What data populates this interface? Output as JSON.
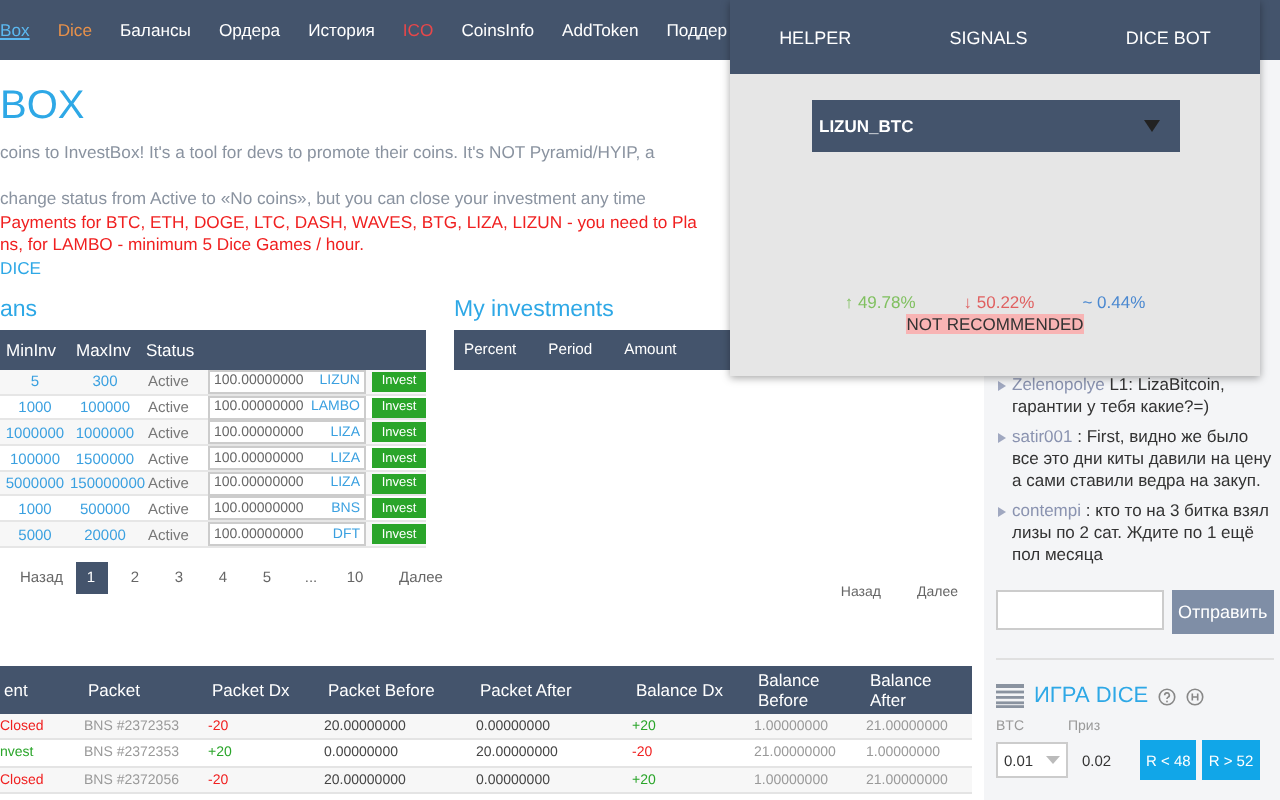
{
  "nav": {
    "items": [
      {
        "label": "Box",
        "selected": true
      },
      {
        "label": "Dice",
        "selected": false,
        "color": "#e8914a"
      },
      {
        "label": "Балансы",
        "selected": false
      },
      {
        "label": "Ордера",
        "selected": false
      },
      {
        "label": "История",
        "selected": false
      },
      {
        "label": "ICO",
        "selected": false,
        "color": "#e8474a"
      },
      {
        "label": "CoinsInfo",
        "selected": false
      },
      {
        "label": "AddToken",
        "selected": false
      },
      {
        "label": "Поддер",
        "selected": false
      }
    ]
  },
  "page_title": "BOX",
  "intro": [
    {
      "kind": "note",
      "text": "coins to InvestBox! It's a tool for devs to promote their coins. It's NOT Pyramid/HYIP, a"
    },
    {
      "kind": "note",
      "text": "change status from Active to «No coins», but you can close your investment any time"
    },
    {
      "kind": "warning",
      "text": "Payments for BTC, ETH, DOGE, LTC, DASH, WAVES, BTG, LIZA, LIZUN - you need to Pla"
    },
    {
      "kind": "warning",
      "text": "ns, for LAMBO - minimum 5 Dice Games / hour."
    },
    {
      "kind": "link",
      "text": "DICE"
    }
  ],
  "plans": {
    "title": "ans",
    "columns": [
      "MinInv",
      "MaxInv",
      "Status"
    ],
    "rows": [
      {
        "min": "5",
        "max": "300",
        "status": "Active",
        "amount": "100.00000000",
        "coin": "LIZUN",
        "button": "Invest"
      },
      {
        "min": "1000",
        "max": "100000",
        "status": "Active",
        "amount": "100.00000000",
        "coin": "LAMBO",
        "button": "Invest"
      },
      {
        "min": "1000000",
        "max": "1000000",
        "status": "Active",
        "amount": "100.00000000",
        "coin": "LIZA",
        "button": "Invest"
      },
      {
        "min": "100000",
        "max": "1500000",
        "status": "Active",
        "amount": "100.00000000",
        "coin": "LIZA",
        "button": "Invest"
      },
      {
        "min": "5000000",
        "max": "150000000",
        "status": "Active",
        "amount": "100.00000000",
        "coin": "LIZA",
        "button": "Invest"
      },
      {
        "min": "1000",
        "max": "500000",
        "status": "Active",
        "amount": "100.00000000",
        "coin": "BNS",
        "button": "Invest"
      },
      {
        "min": "5000",
        "max": "20000",
        "status": "Active",
        "amount": "100.00000000",
        "coin": "DFT",
        "button": "Invest"
      }
    ],
    "pagination": {
      "prev": "Назад",
      "pages": [
        {
          "label": "1",
          "selected": true
        },
        {
          "label": "2",
          "selected": false
        },
        {
          "label": "3",
          "selected": false
        },
        {
          "label": "4",
          "selected": false
        },
        {
          "label": "5",
          "selected": false
        },
        {
          "label": "...",
          "selected": false
        },
        {
          "label": "10",
          "selected": false
        }
      ],
      "next": "Далее"
    }
  },
  "investments": {
    "title": "My investments",
    "columns": [
      "Percent",
      "Period",
      "Amount"
    ],
    "pagination": {
      "prev": "Назад",
      "next": "Далее"
    }
  },
  "history": {
    "columns": [
      "ent",
      "Packet",
      "Packet Dx",
      "Packet Before",
      "Packet After",
      "Balance Dx",
      "Balance Before",
      "Balance After"
    ],
    "rows": [
      {
        "status": {
          "text": "Closed",
          "color": "#f02020"
        },
        "packet": "BNS #2372353",
        "packet_dx": {
          "value": "-20",
          "color": "#f02020"
        },
        "packet_before": "20.00000000",
        "packet_after": "0.00000000",
        "balance_dx": {
          "value": "+20",
          "color": "#2aa52a"
        },
        "balance_before": "1.00000000",
        "balance_after": "21.00000000"
      },
      {
        "status": {
          "text": "nvest",
          "color": "#2aa52a"
        },
        "packet": "BNS #2372353",
        "packet_dx": {
          "value": "+20",
          "color": "#2aa52a"
        },
        "packet_before": "0.00000000",
        "packet_after": "20.00000000",
        "balance_dx": {
          "value": "-20",
          "color": "#f02020"
        },
        "balance_before": "21.00000000",
        "balance_after": "1.00000000"
      },
      {
        "status": {
          "text": "Closed",
          "color": "#f02020"
        },
        "packet": "BNS #2372056",
        "packet_dx": {
          "value": "-20",
          "color": "#f02020"
        },
        "packet_before": "20.00000000",
        "packet_after": "0.00000000",
        "balance_dx": {
          "value": "+20",
          "color": "#2aa52a"
        },
        "balance_before": "1.00000000",
        "balance_after": "21.00000000"
      }
    ]
  },
  "chat": {
    "messages": [
      {
        "user": "Zelenopolye",
        "text": "L1: LizaBitcoin, гарантии у тебя какие?=)"
      },
      {
        "user": "satir001",
        "text": ": First, видно же было все это дни киты давили на цену а сами ставили ведра на закуп."
      },
      {
        "user": "contempi",
        "text": ": кто то на 3 битка взял лизы по 2 сат. Ждите по 1 ещё пол месяца"
      }
    ],
    "send_button": "Отправить"
  },
  "dice": {
    "title": "ИГРА DICE",
    "bet_label": "BTC",
    "bet_value": "0.01",
    "prize_label": "Приз",
    "prize_value": "0.02",
    "buttons": [
      "R < 48",
      "R > 52"
    ]
  },
  "helper_popup": {
    "tabs": [
      {
        "label": "HELPER",
        "selected": false
      },
      {
        "label": "SIGNALS",
        "selected": false
      },
      {
        "label": "DICE BOT",
        "selected": false
      }
    ],
    "pair": "LIZUN_BTC",
    "up": "↑ 49.78%",
    "down": "↓ 50.22%",
    "diff": "~ 0.44%",
    "verdict": "NOT RECOMMENDED"
  }
}
